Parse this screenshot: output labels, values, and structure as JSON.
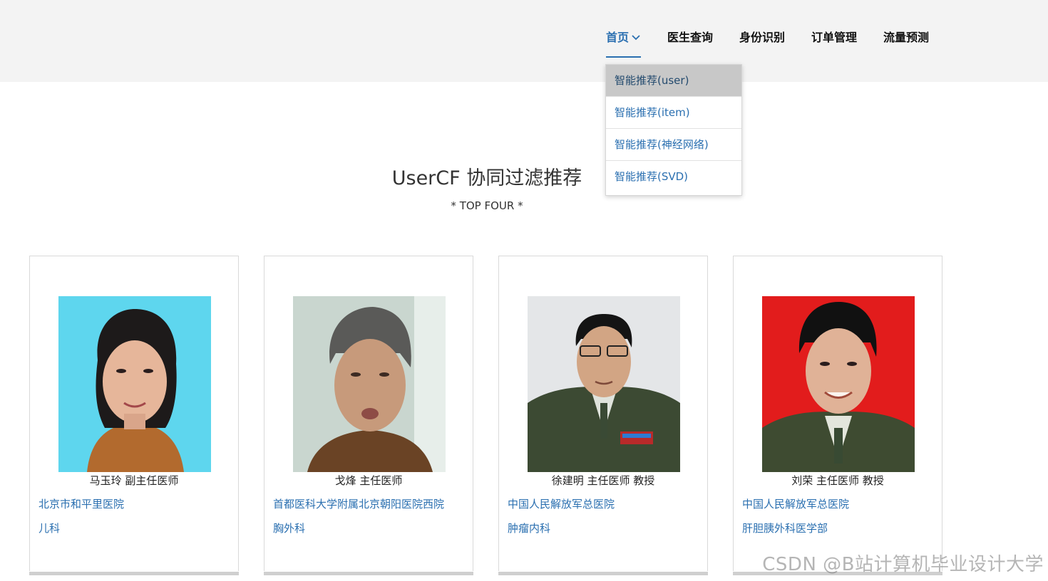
{
  "nav": {
    "items": [
      {
        "label": "首页",
        "active": true
      },
      {
        "label": "医生查询"
      },
      {
        "label": "身份识别"
      },
      {
        "label": "订单管理"
      },
      {
        "label": "流量预测"
      }
    ],
    "accent_color": "#2a6fb0",
    "dropdown": [
      {
        "label": "智能推荐(user)",
        "highlighted": true
      },
      {
        "label": "智能推荐(item)"
      },
      {
        "label": "智能推荐(神经网络)"
      },
      {
        "label": "智能推荐(SVD)"
      }
    ]
  },
  "section": {
    "title": "UserCF 协同过滤推荐",
    "subtitle": "* TOP FOUR *"
  },
  "doctors": [
    {
      "name": "马玉玲 副主任医师",
      "hospital": "北京市和平里医院",
      "department": "儿科",
      "photo_bg": "#5ed6ee"
    },
    {
      "name": "戈烽 主任医师",
      "hospital": "首都医科大学附属北京朝阳医院西院",
      "department": "胸外科",
      "photo_bg": "#c9d6cf"
    },
    {
      "name": "徐建明 主任医师  教授",
      "hospital": "中国人民解放军总医院",
      "department": "肿瘤内科",
      "photo_bg": "#e4e6e8"
    },
    {
      "name": "刘荣 主任医师  教授",
      "hospital": "中国人民解放军总医院",
      "department": "肝胆胰外科医学部",
      "photo_bg": "#e21c1c"
    }
  ],
  "watermark": "CSDN @B站计算机毕业设计大学"
}
